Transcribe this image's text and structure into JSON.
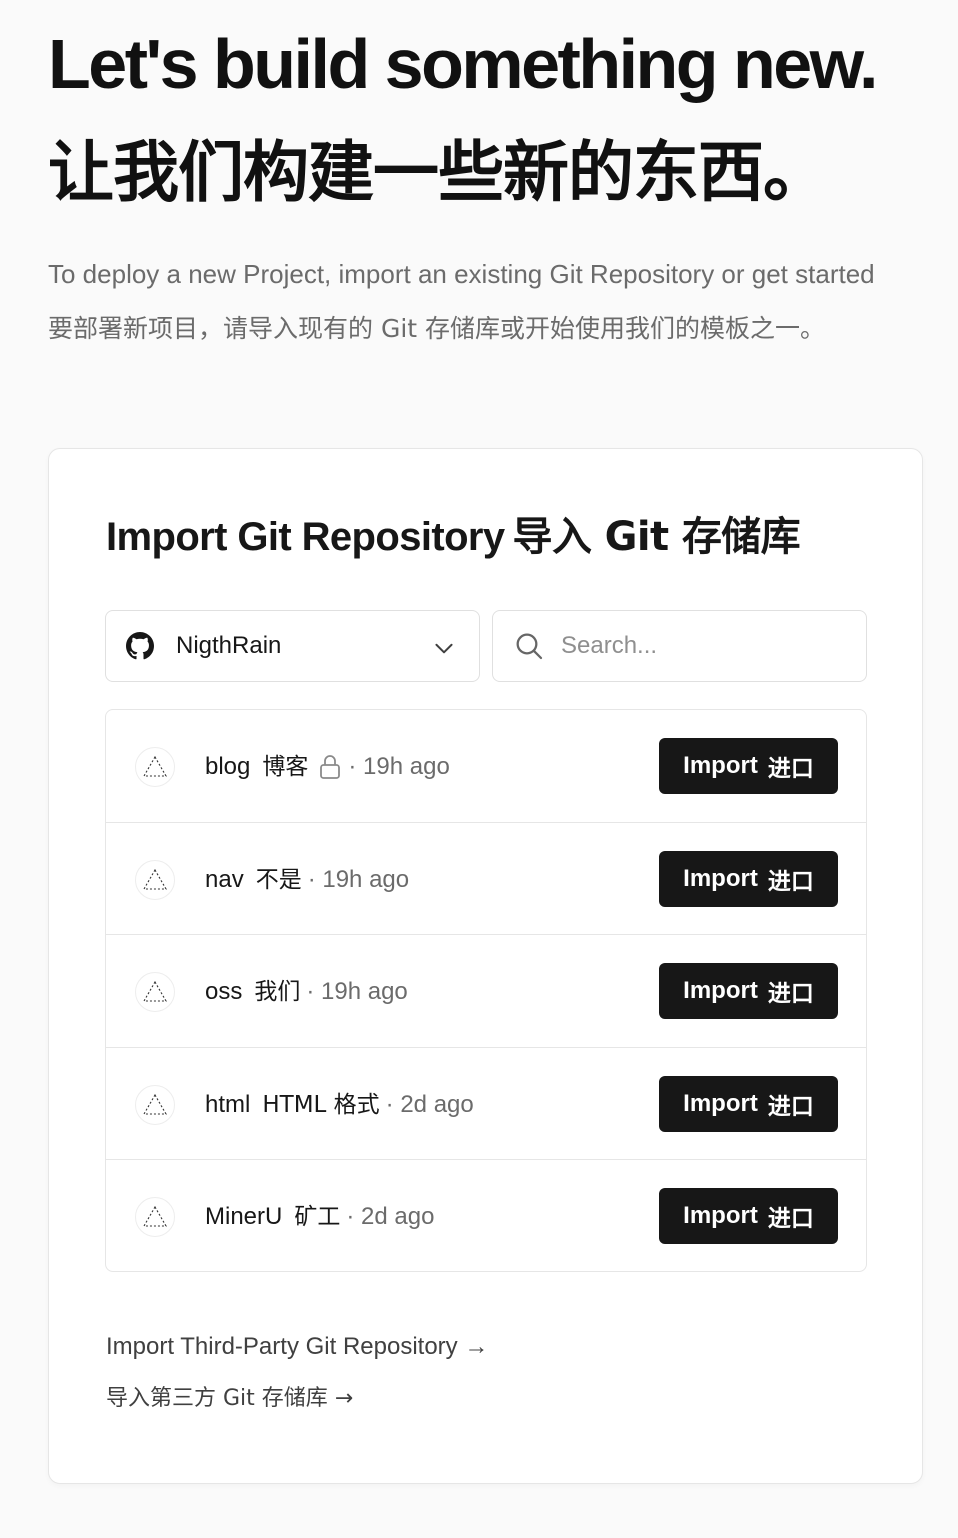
{
  "hero": {
    "title": "Let's build something new.",
    "title_cn": "让我们构建一些新的东西。",
    "subtitle": "To deploy a new Project, import an existing Git Repository or get started",
    "subtitle_cn": "要部署新项目，请导入现有的 Git 存储库或开始使用我们的模板之一。"
  },
  "card": {
    "title": "Import Git Repository",
    "title_cn": "导入 Git 存储库",
    "owner_select": {
      "value": "NigthRain",
      "icon": "github-icon"
    },
    "search": {
      "placeholder": "Search...",
      "value": ""
    },
    "repos": [
      {
        "name": "blog",
        "desc": "博客",
        "private": true,
        "time": "· 19h ago",
        "button": "Import",
        "button_cn": "进口"
      },
      {
        "name": "nav",
        "desc": "不是",
        "private": false,
        "time": "· 19h ago",
        "button": "Import",
        "button_cn": "进口"
      },
      {
        "name": "oss",
        "desc": "我们",
        "private": false,
        "time": "· 19h ago",
        "button": "Import",
        "button_cn": "进口"
      },
      {
        "name": "html",
        "desc": "HTML 格式",
        "private": false,
        "time": "· 2d ago",
        "button": "Import",
        "button_cn": "进口"
      },
      {
        "name": "MinerU",
        "desc": "矿工",
        "private": false,
        "time": "· 2d ago",
        "button": "Import",
        "button_cn": "进口"
      }
    ],
    "third_party": "Import Third-Party Git Repository →",
    "third_party_cn": "导入第三方 Git 存储库 →"
  },
  "colors": {
    "background": "#fafafa",
    "card": "#ffffff",
    "button": "#171717",
    "muted_text": "#6b6b6b"
  }
}
